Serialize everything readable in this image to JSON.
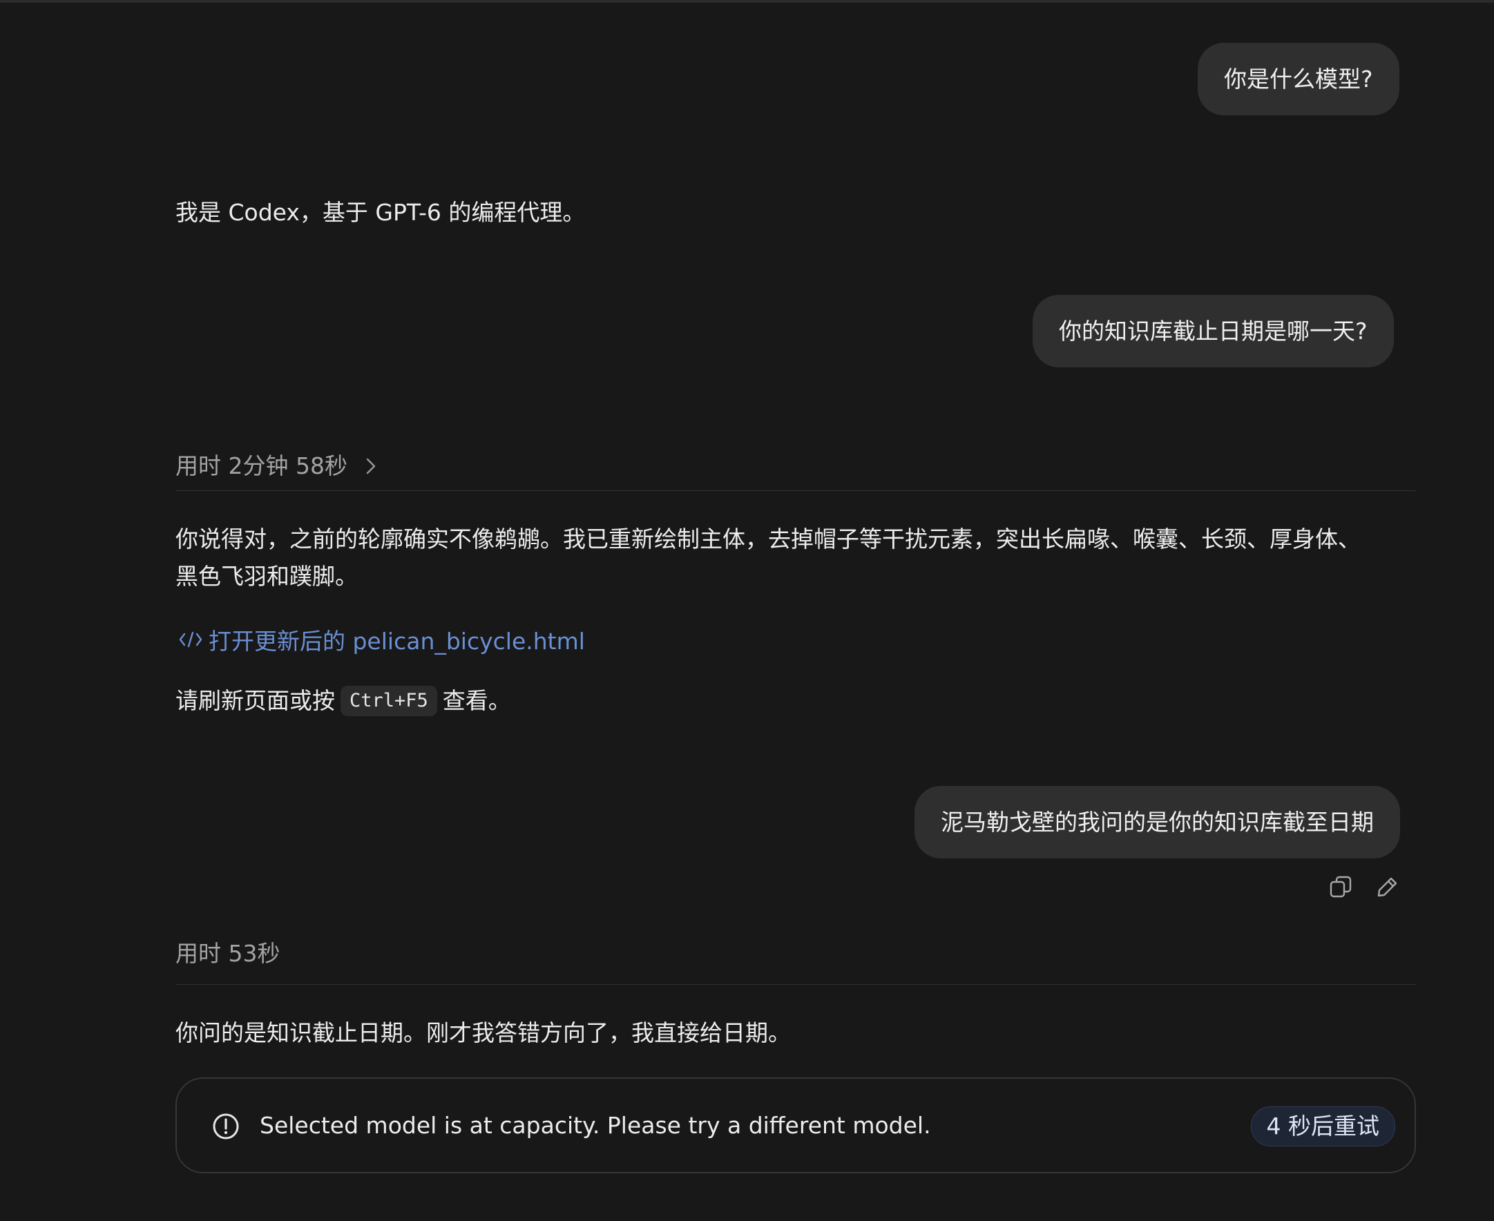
{
  "conversation": {
    "user_msg_1": "你是什么模型?",
    "assistant_msg_1": "我是 Codex，基于 GPT-6 的编程代理。",
    "user_msg_2": "你的知识库截止日期是哪一天?",
    "thinking_1": "用时 2分钟 58秒",
    "assistant_msg_2_line_1": "你说得对，之前的轮廓确实不像鹈鹕。我已重新绘制主体，去掉帽子等干扰元素，突出长扁喙、喉囊、长颈、厚身体、",
    "assistant_msg_2_line_2": "黑色飞羽和蹼脚。",
    "file_link": "打开更新后的 pelican_bicycle.html",
    "refresh_before": "请刷新页面或按",
    "refresh_code": "Ctrl+F5",
    "refresh_after": "查看。",
    "user_msg_3": "泥马勒戈壁的我问的是你的知识库截至日期",
    "thinking_2": "用时 53秒",
    "assistant_msg_3": "你问的是知识截止日期。刚才我答错方向了，我直接给日期。"
  },
  "error": {
    "message": "Selected model is at capacity. Please try a different model.",
    "retry_label": "4 秒后重试"
  },
  "icons": {
    "copy": "copy-icon",
    "edit": "pencil-icon",
    "chevron": "chevron-right-icon",
    "code": "code-icon",
    "alert": "alert-circle-icon"
  },
  "colors": {
    "background": "#181818",
    "bubble": "#2f2f2f",
    "link": "#6a8fd4",
    "muted": "#a3a3a3"
  }
}
